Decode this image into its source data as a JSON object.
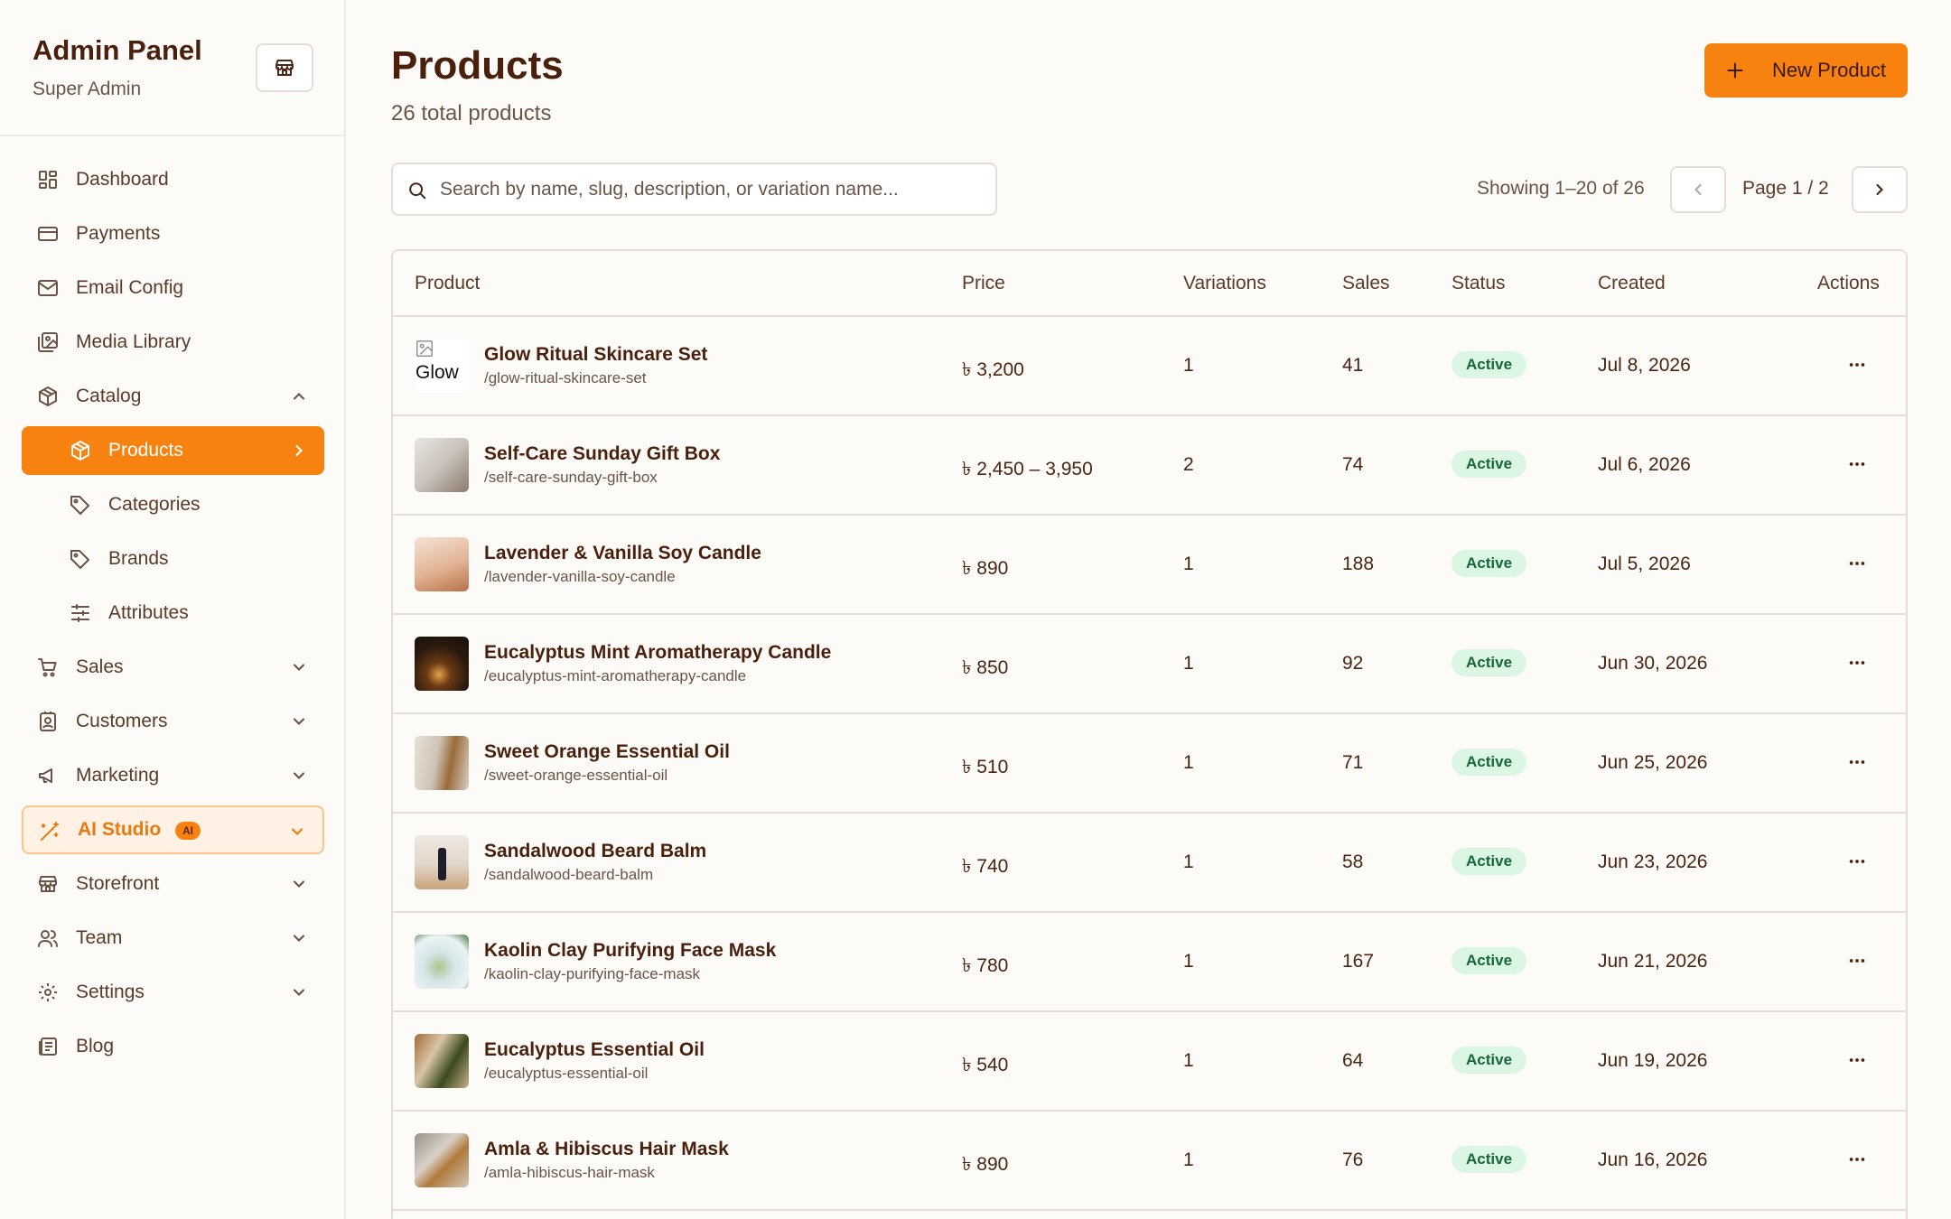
{
  "sidebar": {
    "title": "Admin Panel",
    "subtitle": "Super Admin",
    "store_icon": "store-icon",
    "items": [
      {
        "label": "Dashboard",
        "icon": "dashboard-icon"
      },
      {
        "label": "Payments",
        "icon": "credit-card-icon"
      },
      {
        "label": "Email Config",
        "icon": "mail-icon"
      },
      {
        "label": "Media Library",
        "icon": "images-icon"
      },
      {
        "label": "Catalog",
        "icon": "package-icon",
        "expanded": true
      },
      {
        "label": "Products",
        "icon": "package-icon",
        "active": true
      },
      {
        "label": "Categories",
        "icon": "tag-icon"
      },
      {
        "label": "Brands",
        "icon": "tag-icon"
      },
      {
        "label": "Attributes",
        "icon": "sliders-icon"
      },
      {
        "label": "Sales",
        "icon": "cart-icon"
      },
      {
        "label": "Customers",
        "icon": "contact-icon"
      },
      {
        "label": "Marketing",
        "icon": "megaphone-icon"
      },
      {
        "label": "AI Studio",
        "icon": "wand-icon",
        "badge": "AI"
      },
      {
        "label": "Storefront",
        "icon": "store-icon"
      },
      {
        "label": "Team",
        "icon": "users-icon"
      },
      {
        "label": "Settings",
        "icon": "gear-icon"
      },
      {
        "label": "Blog",
        "icon": "newspaper-icon"
      }
    ]
  },
  "header": {
    "title": "Products",
    "subtitle": "26 total products",
    "new_button": "New Product"
  },
  "search": {
    "placeholder": "Search by name, slug, description, or variation name..."
  },
  "pagination": {
    "showing": "Showing 1–20 of 26",
    "page": "Page 1 / 2"
  },
  "table": {
    "columns": [
      "Product",
      "Price",
      "Variations",
      "Sales",
      "Status",
      "Created",
      "Actions"
    ],
    "rows": [
      {
        "name": "Glow Ritual Skincare Set",
        "slug": "/glow-ritual-skincare-set",
        "price": "৳ 3,200",
        "variations": "1",
        "sales": "41",
        "status": "Active",
        "created": "Jul 8, 2026",
        "thumb_alt": "Glow"
      },
      {
        "name": "Self-Care Sunday Gift Box",
        "slug": "/self-care-sunday-gift-box",
        "price": "৳ 2,450 – 3,950",
        "variations": "2",
        "sales": "74",
        "status": "Active",
        "created": "Jul 6, 2026"
      },
      {
        "name": "Lavender & Vanilla Soy Candle",
        "slug": "/lavender-vanilla-soy-candle",
        "price": "৳ 890",
        "variations": "1",
        "sales": "188",
        "status": "Active",
        "created": "Jul 5, 2026"
      },
      {
        "name": "Eucalyptus Mint Aromatherapy Candle",
        "slug": "/eucalyptus-mint-aromatherapy-candle",
        "price": "৳ 850",
        "variations": "1",
        "sales": "92",
        "status": "Active",
        "created": "Jun 30, 2026"
      },
      {
        "name": "Sweet Orange Essential Oil",
        "slug": "/sweet-orange-essential-oil",
        "price": "৳ 510",
        "variations": "1",
        "sales": "71",
        "status": "Active",
        "created": "Jun 25, 2026"
      },
      {
        "name": "Sandalwood Beard Balm",
        "slug": "/sandalwood-beard-balm",
        "price": "৳ 740",
        "variations": "1",
        "sales": "58",
        "status": "Active",
        "created": "Jun 23, 2026"
      },
      {
        "name": "Kaolin Clay Purifying Face Mask",
        "slug": "/kaolin-clay-purifying-face-mask",
        "price": "৳ 780",
        "variations": "1",
        "sales": "167",
        "status": "Active",
        "created": "Jun 21, 2026"
      },
      {
        "name": "Eucalyptus Essential Oil",
        "slug": "/eucalyptus-essential-oil",
        "price": "৳ 540",
        "variations": "1",
        "sales": "64",
        "status": "Active",
        "created": "Jun 19, 2026"
      },
      {
        "name": "Amla & Hibiscus Hair Mask",
        "slug": "/amla-hibiscus-hair-mask",
        "price": "৳ 890",
        "variations": "1",
        "sales": "76",
        "status": "Active",
        "created": "Jun 16, 2026"
      }
    ]
  },
  "colors": {
    "accent": "#f7820f",
    "active_badge_bg": "#dcf6e4",
    "active_badge_text": "#16673a",
    "title_text": "#4a1f0c"
  }
}
